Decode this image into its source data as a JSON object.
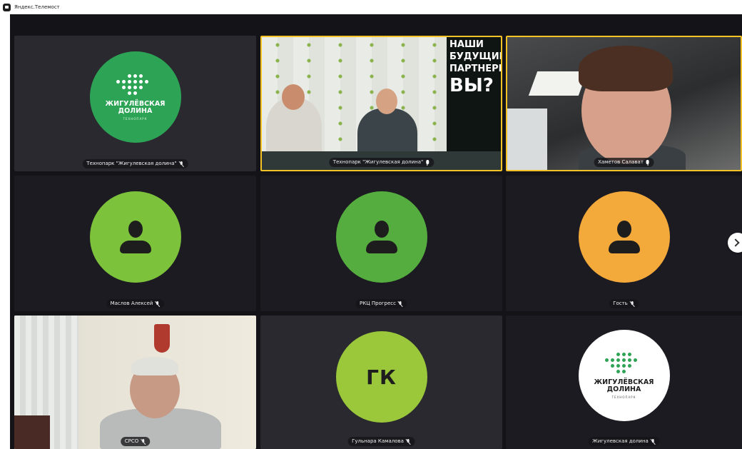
{
  "app": {
    "title": "Яндекс.Телемост"
  },
  "participants": [
    {
      "name": "Технопарк \"Жигулевская долина\"",
      "mic": "off"
    },
    {
      "name": "Технопарк \"Жигулевская долина\"",
      "mic": "on",
      "speaking": true
    },
    {
      "name": "Хаметов Салават",
      "mic": "on",
      "speaking": true
    },
    {
      "name": "Маслов Алексей",
      "mic": "off"
    },
    {
      "name": "РКЦ Прогресс",
      "mic": "off"
    },
    {
      "name": "Гость",
      "mic": "off"
    },
    {
      "name": "СРСО",
      "mic": "off"
    },
    {
      "name": "Гульнара Камалова",
      "mic": "off",
      "initials": "ГК"
    },
    {
      "name": "Жигулевская долина",
      "mic": "off"
    }
  ],
  "logo": {
    "line1": "ЖИГУЛЁВСКАЯ",
    "line2": "ДОЛИНА",
    "sub": "ТЕХНОПАРК"
  },
  "banner": {
    "line1": "НАШИ",
    "line2": "БУДУЩИЕ",
    "line3": "ПАРТНЕРЫ",
    "line4": "ВЫ?"
  },
  "colors": {
    "active_border": "#f5c326",
    "avatar_green_light": "#7dc23b",
    "avatar_green": "#55ad3f",
    "avatar_orange": "#f4a93b",
    "avatar_lime": "#9ac83a",
    "logo_green": "#2da455"
  }
}
